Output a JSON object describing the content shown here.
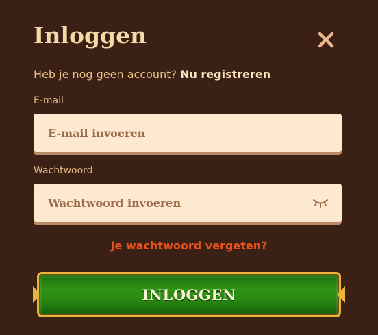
{
  "dialog": {
    "title": "Inloggen",
    "close_icon": "close-icon"
  },
  "register": {
    "prompt": "Heb je nog geen account?",
    "link_label": "Nu registreren"
  },
  "email": {
    "label": "E-mail",
    "placeholder": "E-mail invoeren",
    "value": ""
  },
  "password": {
    "label": "Wachtwoord",
    "placeholder": "Wachtwoord invoeren",
    "value": "",
    "toggle_icon": "eye-closed-icon"
  },
  "forgot_password": {
    "label": "Je wachtwoord vergeten?"
  },
  "login_button": {
    "label": "INLOGGEN"
  },
  "colors": {
    "background": "#3a2015",
    "title": "#f5d9a6",
    "field_bg": "#fde8d0",
    "placeholder": "#9c6b49",
    "link_orange": "#e8521a",
    "button_green": "#2f9415",
    "button_gold": "#e6b53a"
  }
}
